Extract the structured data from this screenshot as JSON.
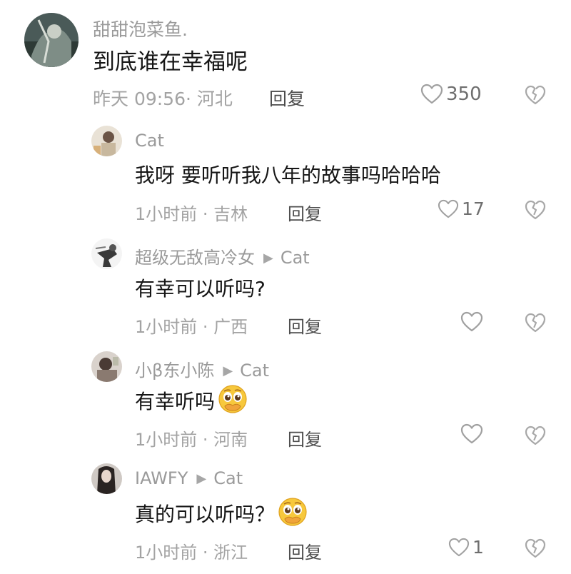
{
  "comments": [
    {
      "user": "甜甜泡菜鱼.",
      "reply_to": "",
      "text": "到底谁在幸福呢",
      "time": "昨天 09:56",
      "location": "河北",
      "reply_label": "回复",
      "likes": "350",
      "has_emoji": false
    },
    {
      "user": "Cat",
      "reply_to": "",
      "text": "我呀 要听听我八年的故事吗哈哈哈",
      "time": "1小时前",
      "location": "吉林",
      "reply_label": "回复",
      "likes": "17",
      "has_emoji": false
    },
    {
      "user": "超级无敌高冷女",
      "reply_to": "Cat",
      "text": "有幸可以听吗?",
      "time": "1小时前",
      "location": "广西",
      "reply_label": "回复",
      "likes": "",
      "has_emoji": false
    },
    {
      "user": "小β东小陈",
      "reply_to": "Cat",
      "text": "有幸听吗",
      "time": "1小时前",
      "location": "河南",
      "reply_label": "回复",
      "likes": "",
      "has_emoji": true
    },
    {
      "user": "IAWFY",
      "reply_to": "Cat",
      "text": "真的可以听吗？",
      "time": "1小时前",
      "location": "浙江",
      "reply_label": "回复",
      "likes": "1",
      "has_emoji": true
    }
  ],
  "icons": {
    "like": "heart-outline-icon",
    "dislike": "broken-heart-icon",
    "reply_arrow": "play-arrow-icon",
    "emoji": "pleading-face-emoji"
  },
  "colors": {
    "username": "#9a9a9a",
    "meta": "#a3a3a3",
    "text": "#161616",
    "icon": "#b0b0b0"
  }
}
